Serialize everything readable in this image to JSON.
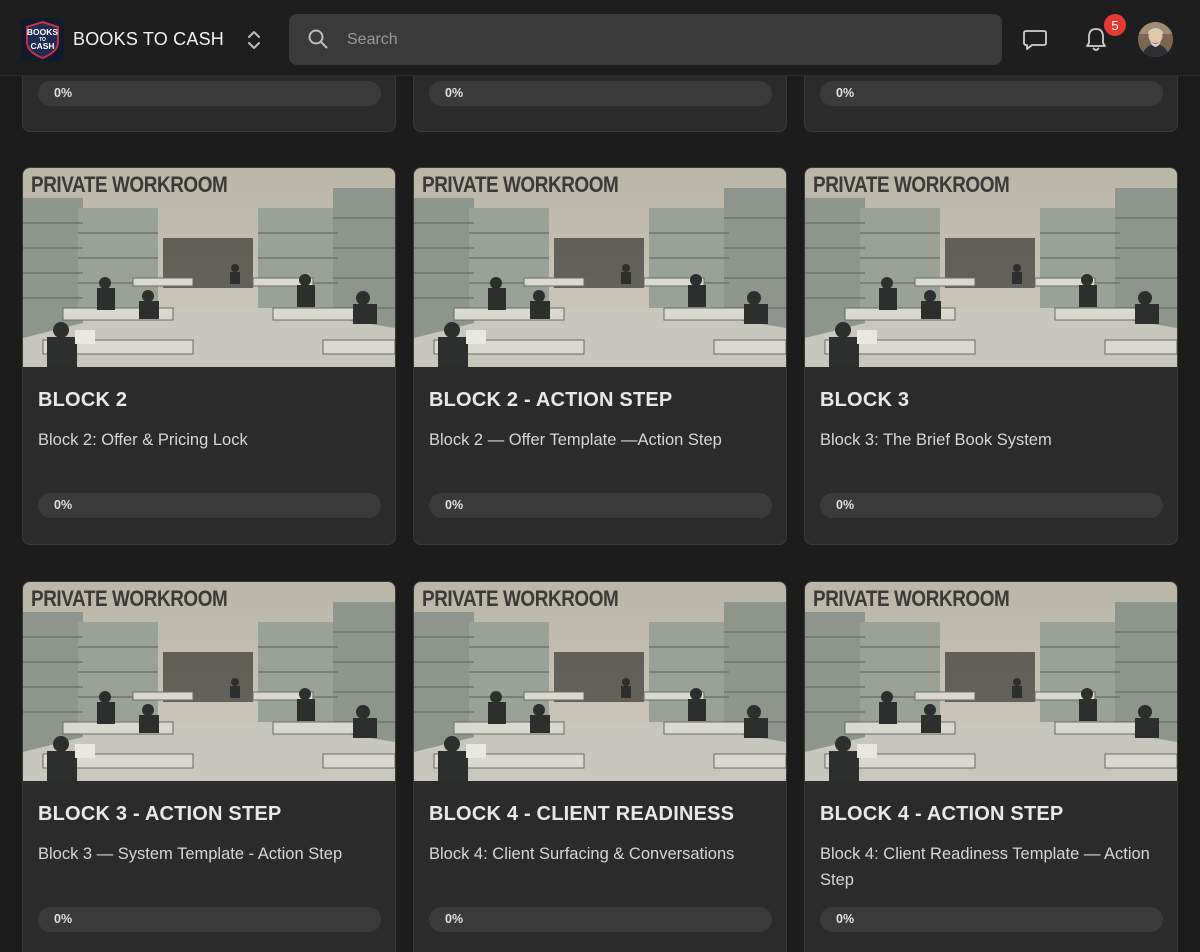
{
  "header": {
    "brand_name": "BOOKS TO CASH",
    "logo_text_top": "BOOKS",
    "logo_text_mid": "TO",
    "logo_text_bottom": "CASH",
    "search_placeholder": "Search",
    "notification_count": "5",
    "icons": [
      "switcher-chevrons-icon",
      "search-icon",
      "chat-icon",
      "bell-icon"
    ]
  },
  "top_row": [
    {
      "progress_label": "0%",
      "progress": 0
    },
    {
      "progress_label": "0%",
      "progress": 0
    },
    {
      "progress_label": "0%",
      "progress": 0
    }
  ],
  "cards": [
    {
      "image_text": "PRIVATE WORKROOM",
      "title": "BLOCK 2",
      "description": "Block 2: Offer & Pricing Lock",
      "progress_label": "0%",
      "progress": 0
    },
    {
      "image_text": "PRIVATE WORKROOM",
      "title": "BLOCK 2 - ACTION STEP",
      "description": "Block 2 — Offer Template —Action Step",
      "progress_label": "0%",
      "progress": 0
    },
    {
      "image_text": "PRIVATE WORKROOM",
      "title": "BLOCK 3",
      "description": "Block 3: The Brief Book System",
      "progress_label": "0%",
      "progress": 0
    },
    {
      "image_text": "PRIVATE WORKROOM",
      "title": "BLOCK 3 - ACTION STEP",
      "description": "Block 3 — System Template - Action Step",
      "progress_label": "0%",
      "progress": 0
    },
    {
      "image_text": "PRIVATE WORKROOM",
      "title": "BLOCK 4 - CLIENT READINESS",
      "description": "Block 4: Client Surfacing & Conversations",
      "progress_label": "0%",
      "progress": 0
    },
    {
      "image_text": "PRIVATE WORKROOM",
      "title": "BLOCK 4 - ACTION STEP",
      "description": "Block 4: Client Readiness Template — Action Step",
      "progress_label": "0%",
      "progress": 0
    }
  ],
  "colors": {
    "background": "#1c1c1c",
    "card": "#2b2b2b",
    "badge": "#e53935",
    "search_bg": "#3a3a3a"
  }
}
